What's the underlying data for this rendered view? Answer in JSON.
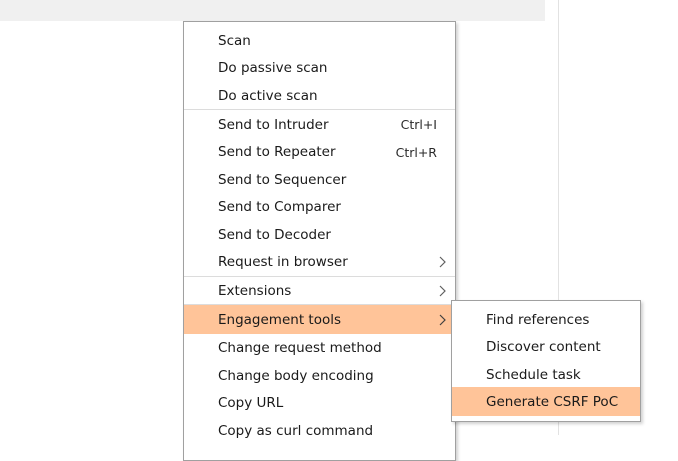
{
  "main_menu": {
    "items": [
      {
        "label": "Scan"
      },
      {
        "label": "Do passive scan"
      },
      {
        "label": "Do active scan"
      },
      {
        "label": "Send to Intruder",
        "shortcut": "Ctrl+I"
      },
      {
        "label": "Send to Repeater",
        "shortcut": "Ctrl+R"
      },
      {
        "label": "Send to Sequencer"
      },
      {
        "label": "Send to Comparer"
      },
      {
        "label": "Send to Decoder"
      },
      {
        "label": "Request in browser"
      },
      {
        "label": "Extensions"
      },
      {
        "label": "Engagement tools"
      },
      {
        "label": "Change request method"
      },
      {
        "label": "Change body encoding"
      },
      {
        "label": "Copy URL"
      },
      {
        "label": "Copy as curl command"
      }
    ]
  },
  "sub_menu": {
    "items": [
      {
        "label": "Find references"
      },
      {
        "label": "Discover content"
      },
      {
        "label": "Schedule task"
      },
      {
        "label": "Generate CSRF PoC"
      }
    ]
  },
  "colors": {
    "highlight": "#ffc499",
    "menu_border": "#a0a0a0",
    "top_strip": "#f0f0f0"
  },
  "icons": {
    "submenu_arrow": "chevron-right-icon"
  }
}
